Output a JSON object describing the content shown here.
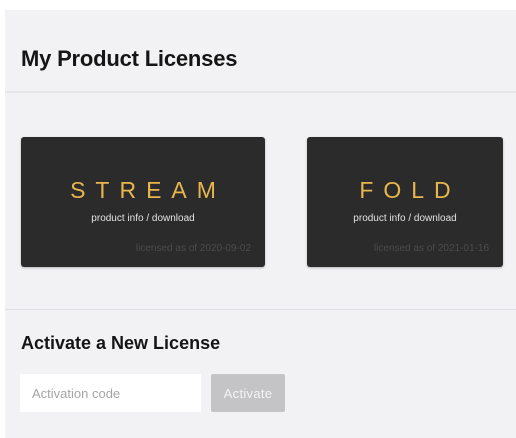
{
  "header": {
    "title": "My Product Licenses"
  },
  "licenses": [
    {
      "name": "STREAM",
      "subtitle": "product info / download",
      "licensed": "licensed as of 2020-09-02"
    },
    {
      "name": "FOLD",
      "subtitle": "product info / download",
      "licensed": "licensed as of 2021-01-16"
    }
  ],
  "activate": {
    "title": "Activate a New License",
    "placeholder": "Activation code",
    "button_label": "Activate"
  },
  "colors": {
    "card_background": "#2b2b2b",
    "product_name": "#e8b64c",
    "button_disabled": "#c4c4c6"
  }
}
